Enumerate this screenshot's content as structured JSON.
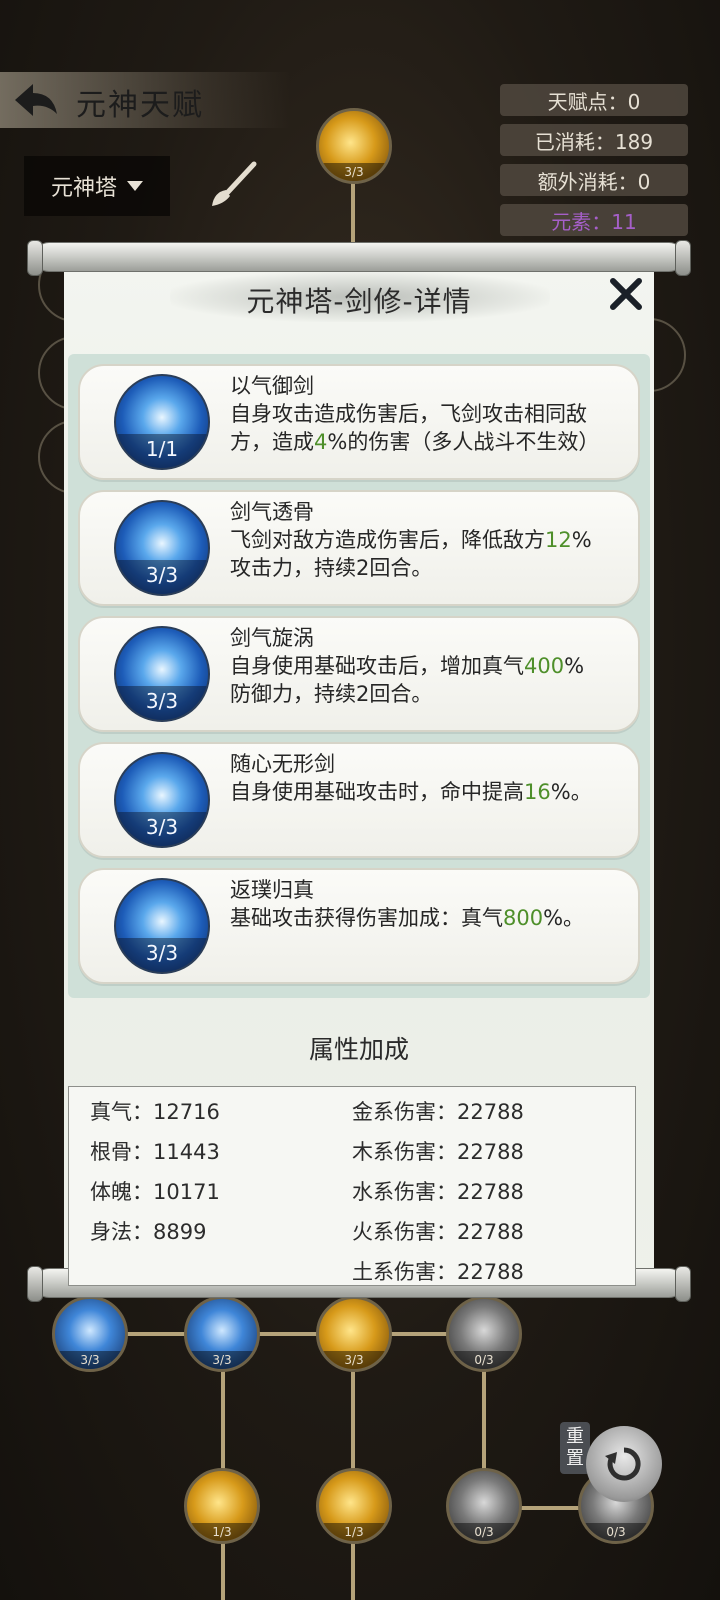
{
  "header": {
    "title": "元神天赋",
    "selector_label": "元神塔",
    "stats": {
      "talent_points": "天赋点：0",
      "consumed": "已消耗：189",
      "extra_consumed": "额外消耗：0",
      "element": "元素：11"
    }
  },
  "tree": {
    "top_node_count": "3/3",
    "bottom_row_counts": [
      "3/3",
      "3/3",
      "3/3",
      "0/3"
    ],
    "lower_row_counts": [
      "1/3",
      "1/3",
      "0/3",
      "0/3"
    ],
    "reset_label": "重置"
  },
  "dialog": {
    "title": "元神塔-剑修-详情",
    "skills": [
      {
        "name": "以气御剑",
        "level": "1/1",
        "desc_pre": "自身攻击造成伤害后，飞剑攻击相同敌方，造成",
        "hl": "4",
        "desc_post": "%的伤害（多人战斗不生效）"
      },
      {
        "name": "剑气透骨",
        "level": "3/3",
        "desc_pre": "飞剑对敌方造成伤害后，降低敌方",
        "hl": "12",
        "desc_post": "%攻击力，持续2回合。"
      },
      {
        "name": "剑气旋涡",
        "level": "3/3",
        "desc_pre": "自身使用基础攻击后，增加真气",
        "hl": "400",
        "desc_post": "%防御力，持续2回合。"
      },
      {
        "name": "随心无形剑",
        "level": "3/3",
        "desc_pre": "自身使用基础攻击时，命中提高",
        "hl": "16",
        "desc_post": "%。"
      },
      {
        "name": "返璞归真",
        "level": "3/3",
        "desc_pre": "基础攻击获得伤害加成：真气",
        "hl": "800",
        "desc_post": "%。"
      }
    ],
    "attr_title": "属性加成",
    "attrs_left": [
      "真气：12716",
      "根骨：11443",
      "体魄：10171",
      "身法：8899"
    ],
    "attrs_right": [
      "金系伤害：22788",
      "木系伤害：22788",
      "水系伤害：22788",
      "火系伤害：22788",
      "土系伤害：22788"
    ]
  }
}
